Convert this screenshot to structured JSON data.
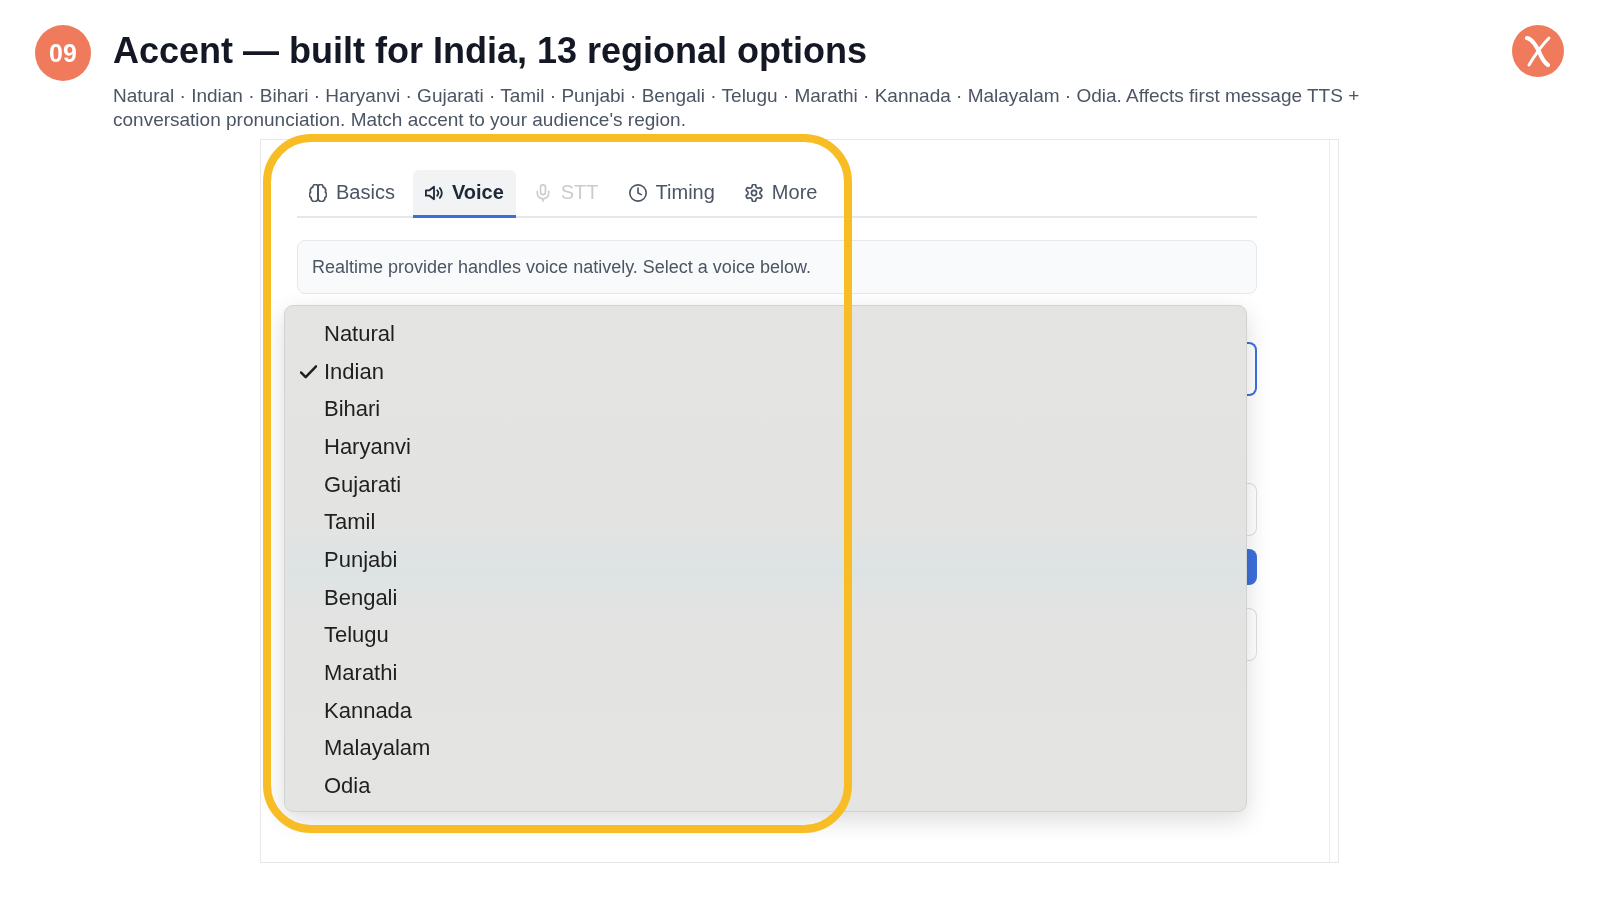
{
  "slide": {
    "number": "09",
    "title": "Accent — built for India, 13 regional options",
    "subtitle": "Natural · Indian · Bihari · Haryanvi · Gujarati · Tamil · Punjabi · Bengali · Telugu · Marathi · Kannada · Malayalam · Odia. Affects first message TTS + conversation pronunciation. Match accent to your audience's region."
  },
  "settings_panel": {
    "tabs": [
      {
        "label": "Basics",
        "selected": false,
        "disabled": false
      },
      {
        "label": "Voice",
        "selected": true,
        "disabled": false
      },
      {
        "label": "STT",
        "selected": false,
        "disabled": true
      },
      {
        "label": "Timing",
        "selected": false,
        "disabled": false
      },
      {
        "label": "More",
        "selected": false,
        "disabled": false
      }
    ],
    "notice": "Realtime provider handles voice natively. Select a voice below.",
    "accent_menu": {
      "options": [
        {
          "label": "Natural",
          "selected": false
        },
        {
          "label": "Indian",
          "selected": true
        },
        {
          "label": "Bihari",
          "selected": false
        },
        {
          "label": "Haryanvi",
          "selected": false
        },
        {
          "label": "Gujarati",
          "selected": false
        },
        {
          "label": "Tamil",
          "selected": false
        },
        {
          "label": "Punjabi",
          "selected": false
        },
        {
          "label": "Bengali",
          "selected": false
        },
        {
          "label": "Telugu",
          "selected": false
        },
        {
          "label": "Marathi",
          "selected": false
        },
        {
          "label": "Kannada",
          "selected": false
        },
        {
          "label": "Malayalam",
          "selected": false
        },
        {
          "label": "Odia",
          "selected": false
        }
      ]
    }
  }
}
